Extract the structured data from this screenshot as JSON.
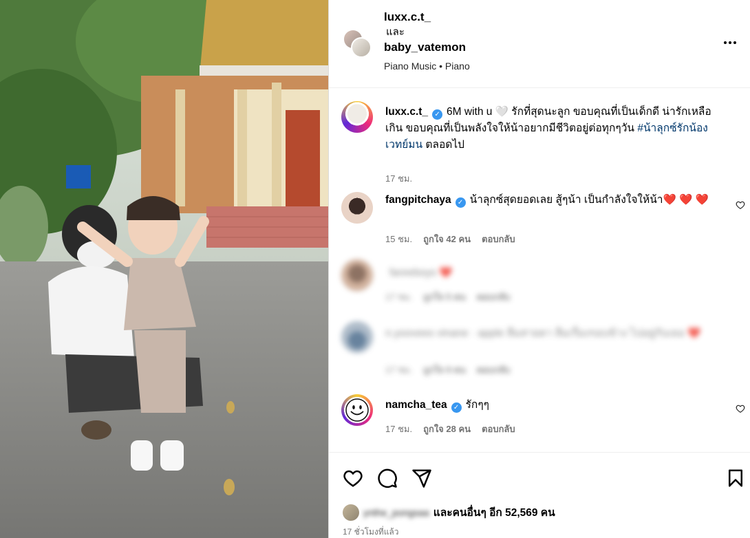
{
  "header": {
    "user1": "luxx.c.t_",
    "and_text": "และ",
    "user2": "baby_vatemon",
    "audio": "Piano Music • Piano"
  },
  "caption": {
    "username": "luxx.c.t_",
    "text": "6M with u 🤍 รักที่สุดนะลูก ขอบคุณที่เป็นเด็กดี น่ารักเหลือเกิน ขอบคุณที่เป็นพลังใจให้น้าอยากมีชีวิตอยู่ต่อทุกๆวัน ",
    "hashtag": "#น้าลุกซ์รักน้องเวทย์มน",
    "tail": " ตลอดไป",
    "time": "17 ชม."
  },
  "comments": [
    {
      "username": "fangpitchaya",
      "text": "น้าลุกซ์สุดยอดเลย สู้ๆน้า เป็นกำลังใจให้น้า❤️ ❤️ ❤️",
      "time": "15 ชม.",
      "likes": "ถูกใจ 42 คน",
      "reply": "ตอบกลับ"
    },
    {
      "username": "",
      "text": "❤️",
      "time": "17 ชม.",
      "likes": "ถูกใจ 5 คน",
      "reply": "ตอบกลับ",
      "blurred": true
    },
    {
      "username": "",
      "text": "❤️",
      "time": "17 ชม.",
      "likes": "ถูกใจ 9 คน",
      "reply": "ตอบกลับ",
      "blurred": true
    },
    {
      "username": "namcha_tea",
      "text": "รักๆๆ",
      "time": "17 ชม.",
      "likes": "ถูกใจ 28 คน",
      "reply": "ตอบกลับ"
    }
  ],
  "likes": {
    "text": "และคนอื่นๆ อีก 52,569 คน"
  },
  "timestamp": "17 ชั่วโมงที่แล้ว",
  "colors": {
    "verified": "#3897f0",
    "heart": "#ed1c24",
    "hashtag": "#00376b",
    "muted": "#737373"
  }
}
